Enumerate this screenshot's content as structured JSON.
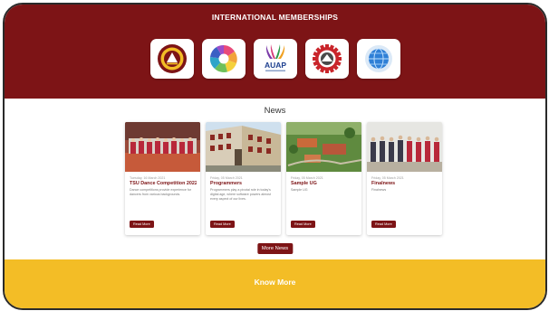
{
  "memberships": {
    "title": "INTERNATIONAL MEMBERSHIPS",
    "logos": [
      {
        "icon": "university-seal-icon"
      },
      {
        "icon": "colorful-pinwheel-icon"
      },
      {
        "icon": "auap-logo-icon",
        "text": "AUAP"
      },
      {
        "icon": "gear-emblem-icon"
      },
      {
        "icon": "globe-network-icon"
      }
    ]
  },
  "news": {
    "title": "News",
    "cards": [
      {
        "date": "Tuesday, 16 March 2021",
        "title": "TSU Dance Competition 2022",
        "description": "Dance competitions provide experience for dancers from various backgrounds.",
        "button": "Read More"
      },
      {
        "date": "Friday, 05 March 2021",
        "title": "Programmers",
        "description": "Programmers play a pivotal role in today's digital age, where software powers almost every aspect of our lives.",
        "button": "Read More"
      },
      {
        "date": "Friday, 05 March 2021",
        "title": "Sample UG",
        "description": "Sample UG",
        "button": "Read More"
      },
      {
        "date": "Friday, 05 March 2021",
        "title": "Finalnews",
        "description": "Finalnews",
        "button": "Read More"
      }
    ],
    "more_button": "More News"
  },
  "know_more": {
    "label": "Know More"
  },
  "colors": {
    "maroon": "#7d1416",
    "gold": "#f3bd26",
    "white": "#ffffff"
  }
}
